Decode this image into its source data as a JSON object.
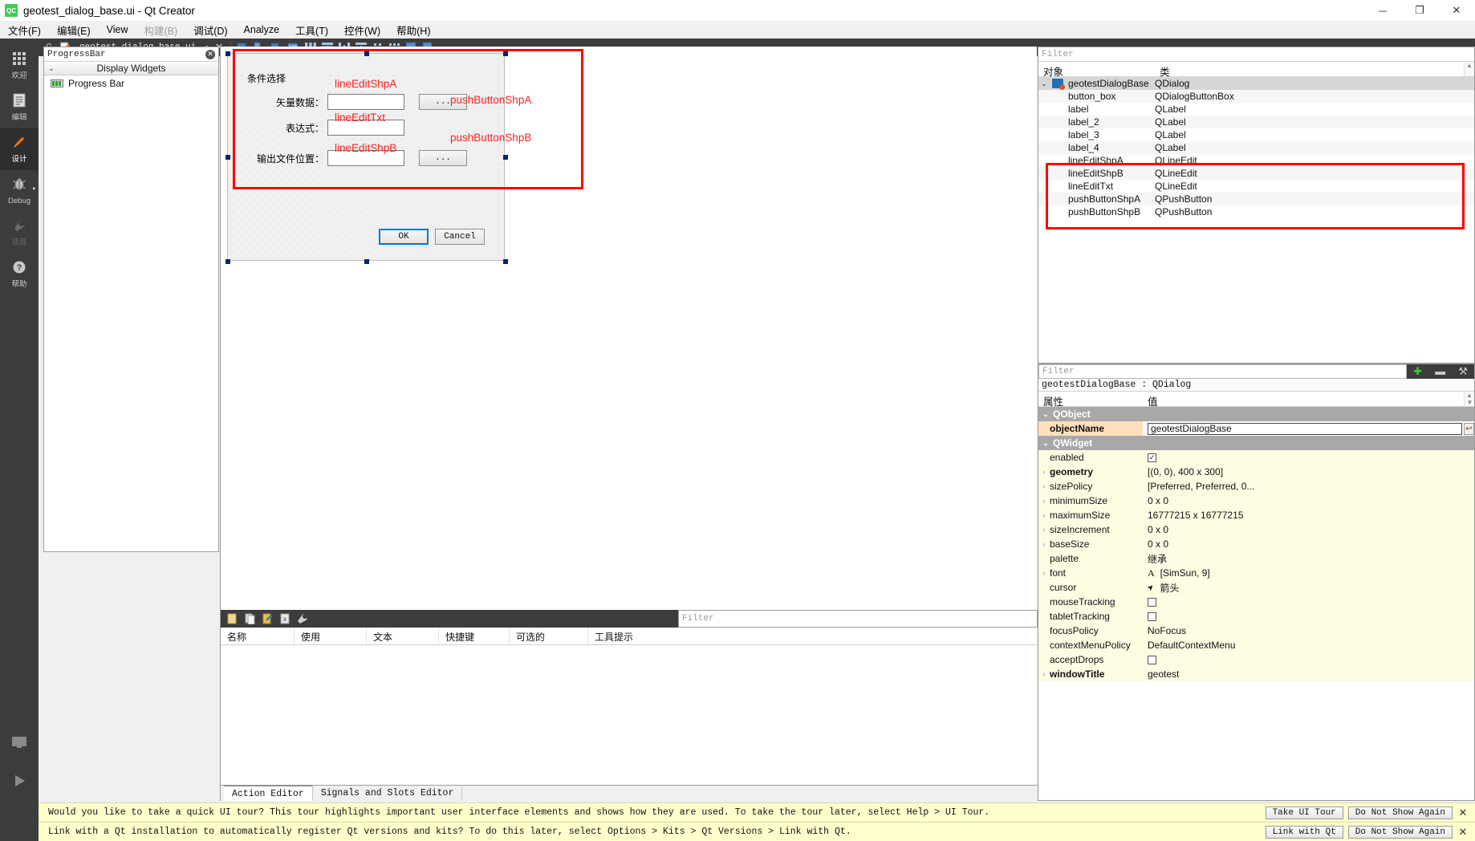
{
  "window": {
    "title": "geotest_dialog_base.ui - Qt Creator",
    "logo_text": "QC",
    "minimize": "─",
    "maximize": "❐",
    "close": "✕"
  },
  "menubar": {
    "items": [
      {
        "label": "文件(F)",
        "disabled": false
      },
      {
        "label": "编辑(E)",
        "disabled": false
      },
      {
        "label": "View",
        "disabled": false
      },
      {
        "label": "构建(B)",
        "disabled": true
      },
      {
        "label": "调试(D)",
        "disabled": false
      },
      {
        "label": "Analyze",
        "disabled": false
      },
      {
        "label": "工具(T)",
        "disabled": false
      },
      {
        "label": "控件(W)",
        "disabled": false
      },
      {
        "label": "帮助(H)",
        "disabled": false
      }
    ]
  },
  "modebar": {
    "items": [
      {
        "label": "欢迎",
        "icon": "grid-icon",
        "glyph": "⁙",
        "state": "normal"
      },
      {
        "label": "编辑",
        "icon": "document-icon",
        "glyph": "☰",
        "state": "normal"
      },
      {
        "label": "设计",
        "icon": "pencil-icon",
        "glyph": "✎",
        "state": "selected"
      },
      {
        "label": "Debug",
        "icon": "bug-icon",
        "glyph": "⚘",
        "state": "normal",
        "arrow": "▸"
      },
      {
        "label": "项目",
        "icon": "wrench-icon",
        "glyph": "⚒",
        "state": "disabled"
      },
      {
        "label": "帮助",
        "icon": "question-icon",
        "glyph": "?",
        "state": "normal"
      }
    ],
    "bottom": [
      {
        "label": "",
        "icon": "monitor-icon",
        "glyph": "▭"
      },
      {
        "label": "",
        "icon": "run-icon",
        "glyph": "▶"
      },
      {
        "label": "",
        "icon": "hammer-icon",
        "glyph": "⚒"
      }
    ]
  },
  "file_toolbar": {
    "lock_icon": "lock-icon",
    "doc_icon": "file-edit-icon",
    "filename": "geotest_dialog_base.ui",
    "caret": "▾",
    "close_icon": "close-icon",
    "designer_tools": [
      {
        "name": "edit-widgets-icon",
        "glyph": "◰"
      },
      {
        "name": "edit-signals-slots-icon",
        "glyph": "↖"
      },
      {
        "name": "edit-buddies-icon",
        "glyph": "◱"
      },
      {
        "name": "edit-tab-order-icon",
        "glyph": "⊞"
      },
      {
        "name": "layout-horizontally-icon",
        "glyph": "‖‖"
      },
      {
        "name": "layout-vertically-icon",
        "glyph": "☰"
      },
      {
        "name": "layout-splitter-h-icon",
        "glyph": "⧺"
      },
      {
        "name": "layout-splitter-v-icon",
        "glyph": "⧻"
      },
      {
        "name": "layout-form-icon",
        "glyph": "∷"
      },
      {
        "name": "layout-grid-icon",
        "glyph": "∷"
      },
      {
        "name": "break-layout-icon",
        "glyph": "▦"
      },
      {
        "name": "adjust-size-icon",
        "glyph": "↖"
      }
    ]
  },
  "widget_box": {
    "filter_text": "ProgressBar",
    "clear_icon": "clear-icon",
    "chevron": "⌄",
    "group_title": "Display Widgets",
    "items": [
      {
        "label": "Progress Bar",
        "icon": "progress-bar-icon"
      }
    ]
  },
  "form": {
    "groupbox_title": "条件选择",
    "rows": [
      {
        "label": "矢量数据：",
        "field_annot": "lineEditShpA",
        "button_text": "...",
        "button_annot": "pushButtonShpA"
      },
      {
        "label": "表达式：",
        "field_annot": "lineEditTxt",
        "button_text": "",
        "button_annot": ""
      },
      {
        "label": "输出文件位置：",
        "field_annot": "lineEditShpB",
        "button_text": "...",
        "button_annot": "pushButtonShpB"
      }
    ],
    "ok_label": "OK",
    "cancel_label": "Cancel"
  },
  "object_inspector": {
    "filter_placeholder": "Filter",
    "columns": [
      "对象",
      "类"
    ],
    "rows": [
      {
        "name": "geotestDialogBase",
        "class": "QDialog",
        "indent": 0,
        "expander": "⌄",
        "icon": "dialog-icon",
        "selected": true,
        "highlighted": false
      },
      {
        "name": "button_box",
        "class": "QDialogButtonBox",
        "indent": 1,
        "selected": false,
        "highlighted": false
      },
      {
        "name": "label",
        "class": "QLabel",
        "indent": 1,
        "selected": false,
        "highlighted": false
      },
      {
        "name": "label_2",
        "class": "QLabel",
        "indent": 1,
        "selected": false,
        "highlighted": false
      },
      {
        "name": "label_3",
        "class": "QLabel",
        "indent": 1,
        "selected": false,
        "highlighted": false
      },
      {
        "name": "label_4",
        "class": "QLabel",
        "indent": 1,
        "selected": false,
        "highlighted": false
      },
      {
        "name": "lineEditShpA",
        "class": "QLineEdit",
        "indent": 1,
        "selected": false,
        "highlighted": true
      },
      {
        "name": "lineEditShpB",
        "class": "QLineEdit",
        "indent": 1,
        "selected": false,
        "highlighted": true
      },
      {
        "name": "lineEditTxt",
        "class": "QLineEdit",
        "indent": 1,
        "selected": false,
        "highlighted": true
      },
      {
        "name": "pushButtonShpA",
        "class": "QPushButton",
        "indent": 1,
        "selected": false,
        "highlighted": true
      },
      {
        "name": "pushButtonShpB",
        "class": "QPushButton",
        "indent": 1,
        "selected": false,
        "highlighted": true
      }
    ]
  },
  "property_editor": {
    "filter_placeholder": "Filter",
    "tools": [
      {
        "name": "add-property-icon",
        "glyph": "✚",
        "color": "#3ec93e"
      },
      {
        "name": "remove-property-icon",
        "glyph": "➖",
        "color": "#c8c8c8"
      },
      {
        "name": "configure-icon",
        "glyph": "⚒",
        "color": "#c8c8c8"
      }
    ],
    "object_line": "geotestDialogBase : QDialog",
    "columns": [
      "属性",
      "值"
    ],
    "groups": [
      {
        "name": "QObject",
        "chevron": "⌄",
        "rows": [
          {
            "key": "objectName",
            "value": "geotestDialogBase",
            "kind": "edit",
            "bold": true,
            "expandable": false,
            "style": "on"
          }
        ]
      },
      {
        "name": "QWidget",
        "chevron": "⌄",
        "rows": [
          {
            "key": "enabled",
            "value": "✓",
            "kind": "checkbox",
            "checked": true,
            "bold": false,
            "expandable": false,
            "style": "y1"
          },
          {
            "key": "geometry",
            "value": "[(0, 0), 400 x 300]",
            "kind": "text",
            "bold": true,
            "expandable": true,
            "style": "y1"
          },
          {
            "key": "sizePolicy",
            "value": "[Preferred, Preferred, 0...",
            "kind": "text",
            "bold": false,
            "expandable": true,
            "style": "y1"
          },
          {
            "key": "minimumSize",
            "value": "0 x 0",
            "kind": "text",
            "bold": false,
            "expandable": true,
            "style": "y1"
          },
          {
            "key": "maximumSize",
            "value": "16777215 x 16777215",
            "kind": "text",
            "bold": false,
            "expandable": true,
            "style": "y1"
          },
          {
            "key": "sizeIncrement",
            "value": "0 x 0",
            "kind": "text",
            "bold": false,
            "expandable": true,
            "style": "y1"
          },
          {
            "key": "baseSize",
            "value": "0 x 0",
            "kind": "text",
            "bold": false,
            "expandable": true,
            "style": "y1"
          },
          {
            "key": "palette",
            "value": "继承",
            "kind": "text",
            "bold": false,
            "expandable": false,
            "style": "y1"
          },
          {
            "key": "font",
            "value": "[SimSun, 9]",
            "kind": "font",
            "glyph": "A",
            "bold": false,
            "expandable": true,
            "style": "y1"
          },
          {
            "key": "cursor",
            "value": "箭头",
            "kind": "cursor",
            "glyph": "➤",
            "bold": false,
            "expandable": false,
            "style": "y1"
          },
          {
            "key": "mouseTracking",
            "value": "",
            "kind": "checkbox",
            "checked": false,
            "bold": false,
            "expandable": false,
            "style": "y1"
          },
          {
            "key": "tabletTracking",
            "value": "",
            "kind": "checkbox",
            "checked": false,
            "bold": false,
            "expandable": false,
            "style": "y1"
          },
          {
            "key": "focusPolicy",
            "value": "NoFocus",
            "kind": "text",
            "bold": false,
            "expandable": false,
            "style": "y1"
          },
          {
            "key": "contextMenuPolicy",
            "value": "DefaultContextMenu",
            "kind": "text",
            "bold": false,
            "expandable": false,
            "style": "y1"
          },
          {
            "key": "acceptDrops",
            "value": "",
            "kind": "checkbox",
            "checked": false,
            "bold": false,
            "expandable": false,
            "style": "y1"
          },
          {
            "key": "windowTitle",
            "value": "geotest",
            "kind": "text",
            "bold": true,
            "expandable": true,
            "style": "y1"
          }
        ]
      }
    ]
  },
  "action_editor": {
    "toolbar_icons": [
      {
        "name": "new-action-icon",
        "glyph": "▭"
      },
      {
        "name": "copy-action-icon",
        "glyph": "⧉"
      },
      {
        "name": "edit-action-icon",
        "glyph": "✎"
      },
      {
        "name": "delete-action-icon",
        "glyph": "✕"
      },
      {
        "name": "configure-action-icon",
        "glyph": "⚒"
      }
    ],
    "filter_placeholder": "Filter",
    "columns": [
      "名称",
      "使用",
      "文本",
      "快捷键",
      "可选的",
      "工具提示"
    ],
    "tabs": [
      {
        "label": "Action Editor",
        "active": true
      },
      {
        "label": "Signals and Slots Editor",
        "active": false
      }
    ]
  },
  "info_bars": [
    {
      "message": "Would you like to take a quick UI tour? This tour highlights important user interface elements and shows how they are used. To take the tour later, select Help > UI Tour.",
      "primary": "Take UI Tour",
      "secondary": "Do Not Show Again",
      "close": "✕"
    },
    {
      "message": "Link with a Qt installation to automatically register Qt versions and kits? To do this later, select Options > Kits > Qt Versions > Link with Qt.",
      "primary": "Link with Qt",
      "secondary": "Do Not Show Again",
      "close": "✕"
    }
  ],
  "colors": {
    "annotation_red": "#ff2020",
    "highlight_red": "#ff0000",
    "selection_blue": "#0a246a",
    "dark_chrome": "#3c3c3c",
    "qt_green": "#41cd52",
    "info_yellow": "#ffffcc",
    "prop_yellow": "#fdfde4",
    "prop_orange": "#ffe0bb"
  }
}
